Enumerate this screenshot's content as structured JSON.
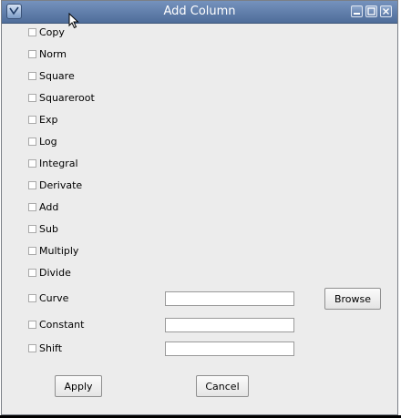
{
  "window": {
    "title": "Add Column",
    "controls": [
      "minimize-icon",
      "maximize-icon",
      "close-icon"
    ]
  },
  "options": [
    {
      "label": "Copy",
      "checked": false
    },
    {
      "label": "Norm",
      "checked": false
    },
    {
      "label": "Square",
      "checked": false
    },
    {
      "label": "Squareroot",
      "checked": false
    },
    {
      "label": "Exp",
      "checked": false
    },
    {
      "label": "Log",
      "checked": false
    },
    {
      "label": "Integral",
      "checked": false
    },
    {
      "label": "Derivate",
      "checked": false
    },
    {
      "label": "Add",
      "checked": false
    },
    {
      "label": "Sub",
      "checked": false
    },
    {
      "label": "Multiply",
      "checked": false
    },
    {
      "label": "Divide",
      "checked": false
    }
  ],
  "curve": {
    "label": "Curve",
    "checked": false,
    "value": "",
    "browse_label": "Browse"
  },
  "constant": {
    "label": "Constant",
    "checked": false,
    "value": ""
  },
  "shift": {
    "label": "Shift",
    "checked": false,
    "value": ""
  },
  "actions": {
    "apply_label": "Apply",
    "cancel_label": "Cancel"
  }
}
